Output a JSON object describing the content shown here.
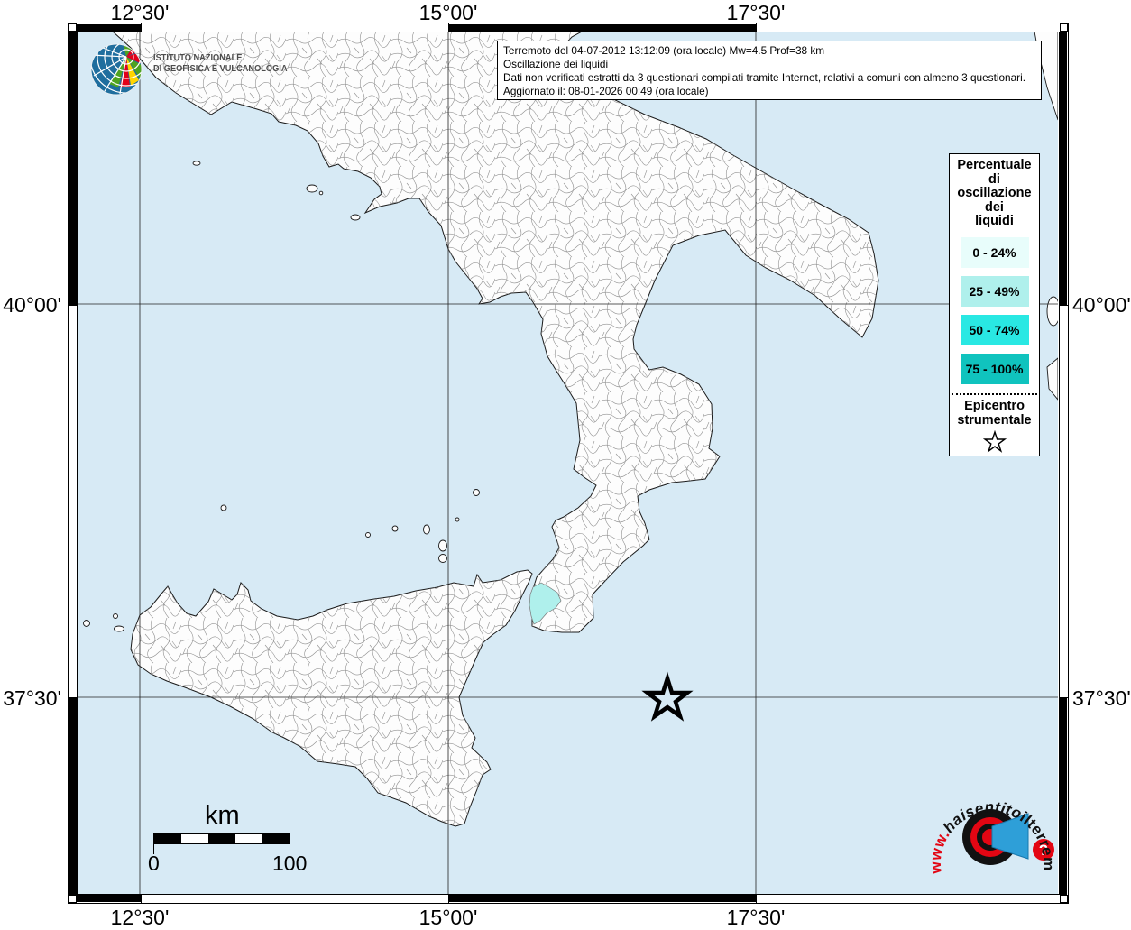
{
  "header": {
    "info_lines": [
      "Terremoto del 04-07-2012 13:12:09 (ora locale) Mw=4.5 Prof=38 km",
      "Oscillazione dei liquidi",
      "Dati non verificati estratti da 3 questionari compilati tramite Internet, relativi a comuni con almeno 3 questionari.",
      "Aggiornato il: 08-01-2026 00:49 (ora locale)"
    ]
  },
  "ingv_logo": {
    "line1": "ISTITUTO NAZIONALE",
    "line2": "DI GEOFISICA E VULCANOLOGIA"
  },
  "legend": {
    "title_lines": [
      "Percentuale",
      "di",
      "oscillazione",
      "dei",
      "liquidi"
    ],
    "classes": [
      {
        "label": "0 - 24%",
        "color": "#e8fdfb"
      },
      {
        "label": "25 - 49%",
        "color": "#aff0ec"
      },
      {
        "label": "50 - 74%",
        "color": "#29e8e3"
      },
      {
        "label": "75 - 100%",
        "color": "#10c3be"
      }
    ],
    "epicenter_label_lines": [
      "Epicentro",
      "strumentale"
    ]
  },
  "axes": {
    "top": [
      "12°30'",
      "15°00'",
      "17°30'"
    ],
    "bottom": [
      "12°30'",
      "15°00'",
      "17°30'"
    ],
    "left": [
      "40°00'",
      "37°30'"
    ],
    "right": [
      "40°00'",
      "37°30'"
    ]
  },
  "scalebar": {
    "unit": "km",
    "min": "0",
    "max": "100"
  },
  "site_logo": {
    "www": "www.",
    "name1": "haisentito",
    "name2": "ilterremoto",
    "tld": ".it",
    "question": "?"
  },
  "map_colors": {
    "sea": "#d7eaf5",
    "land": "#fdfdfd",
    "municipality_border": "#8f8f8f",
    "highlight": "#aff0ec"
  }
}
